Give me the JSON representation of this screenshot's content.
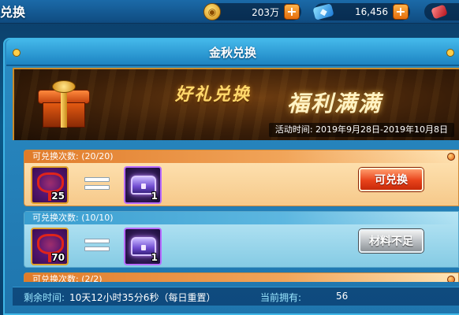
{
  "window": {
    "title": "兑换"
  },
  "resources": {
    "gold": {
      "icon": "gold-coin-icon",
      "value": "203万"
    },
    "diamond": {
      "icon": "diamond-icon",
      "value": "16,456"
    },
    "ruby": {
      "icon": "ruby-icon"
    },
    "plus_label": "+"
  },
  "panel": {
    "title": "金秋兑换"
  },
  "banner": {
    "slogan_left": "好礼兑换",
    "slogan_right": "福利满满",
    "period_label": "活动时间:",
    "period_value": "2019年9月28日-2019年10月8日"
  },
  "exchange_items": [
    {
      "count_label": "可兑换次数:",
      "count_value": "(20/20)",
      "material": {
        "icon": "red-chinese-knot-icon",
        "quantity": "25"
      },
      "reward": {
        "icon": "purple-treasure-chest-icon",
        "quantity": "1"
      },
      "action_label": "可兑换",
      "state": "available"
    },
    {
      "count_label": "可兑换次数:",
      "count_value": "(10/10)",
      "material": {
        "icon": "red-chinese-knot-icon",
        "quantity": "70"
      },
      "reward": {
        "icon": "purple-treasure-chest-icon",
        "quantity": "1"
      },
      "action_label": "材料不足",
      "state": "insufficient"
    },
    {
      "count_label": "可兑换次数:",
      "count_value": "(2/2)"
    }
  ],
  "footer": {
    "remaining_label": "剩余时间:",
    "remaining_value": "10天12小时35分6秒（每日重置）",
    "owned_label": "当前拥有:",
    "owned_value": "56"
  },
  "colors": {
    "accent_orange": "#e8421a",
    "panel_blue": "#1d84c2",
    "banner_gold": "#ffd86b"
  }
}
